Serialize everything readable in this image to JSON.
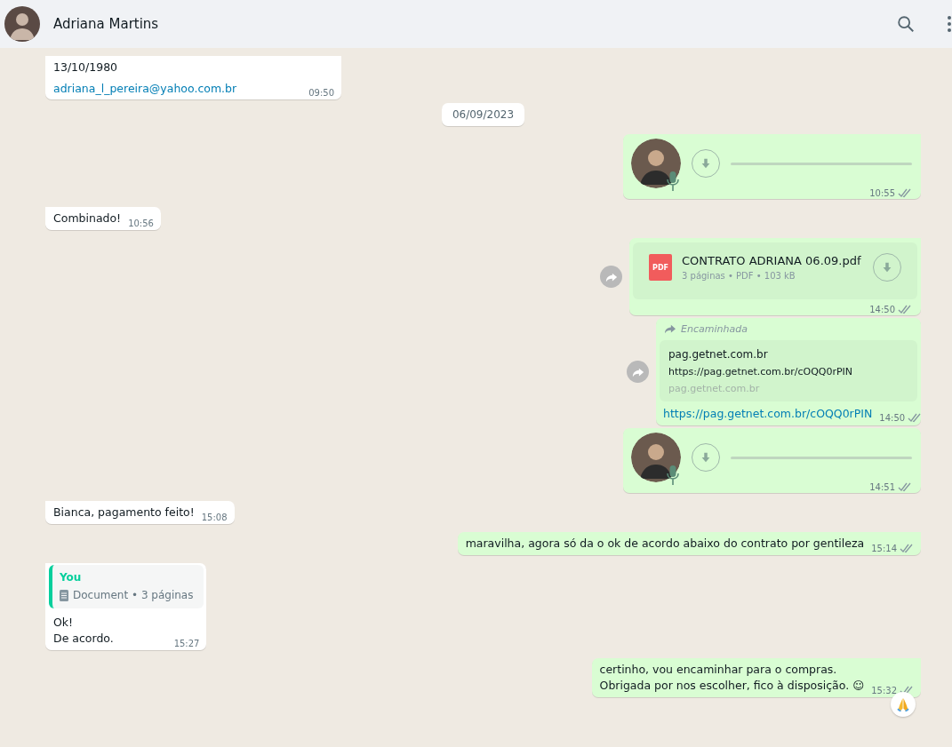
{
  "header": {
    "name": "Adriana Martins"
  },
  "messages": [
    {
      "kind": "contact",
      "outgoing": false,
      "lines": [
        "13/10/1980"
      ],
      "link": "adriana_l_pereira@yahoo.com.br",
      "time": "09:50"
    },
    {
      "kind": "date",
      "text": "06/09/2023"
    },
    {
      "kind": "audio",
      "outgoing": true,
      "time": "10:55",
      "read": false
    },
    {
      "kind": "text",
      "outgoing": false,
      "lines": [
        "Combinado!"
      ],
      "time": "10:56"
    },
    {
      "kind": "document",
      "outgoing": true,
      "icon_label": "PDF",
      "name": "CONTRATO ADRIANA 06.09.pdf",
      "meta": "3 páginas • PDF • 103 kB",
      "time": "14:50",
      "read": false,
      "forward_button": true
    },
    {
      "kind": "link",
      "outgoing": true,
      "forwarded": "Encaminhada",
      "preview_title": "pag.getnet.com.br",
      "preview_url": "https://pag.getnet.com.br/cOQQ0rPIN",
      "preview_domain": "pag.getnet.com.br",
      "link": "https://pag.getnet.com.br/cOQQ0rPIN",
      "time": "14:50",
      "read": false,
      "forward_button": true
    },
    {
      "kind": "audio",
      "outgoing": true,
      "time": "14:51",
      "read": false
    },
    {
      "kind": "text",
      "outgoing": false,
      "lines": [
        "Bianca, pagamento feito!"
      ],
      "time": "15:08"
    },
    {
      "kind": "text",
      "outgoing": true,
      "lines": [
        "maravilha, agora só da o ok de acordo abaixo do contrato por gentileza"
      ],
      "time": "15:14",
      "read": false
    },
    {
      "kind": "quoted",
      "outgoing": false,
      "quote_author": "You",
      "quote_text": "Document • 3 páginas",
      "lines": [
        "Ok!",
        "De acordo."
      ],
      "time": "15:27"
    },
    {
      "kind": "text",
      "outgoing": true,
      "lines": [
        "certinho, vou encaminhar para o compras.",
        "Obrigada por nos escolher, fico à disposição. ☺"
      ],
      "time": "15:32",
      "read": false,
      "reaction": true
    }
  ]
}
